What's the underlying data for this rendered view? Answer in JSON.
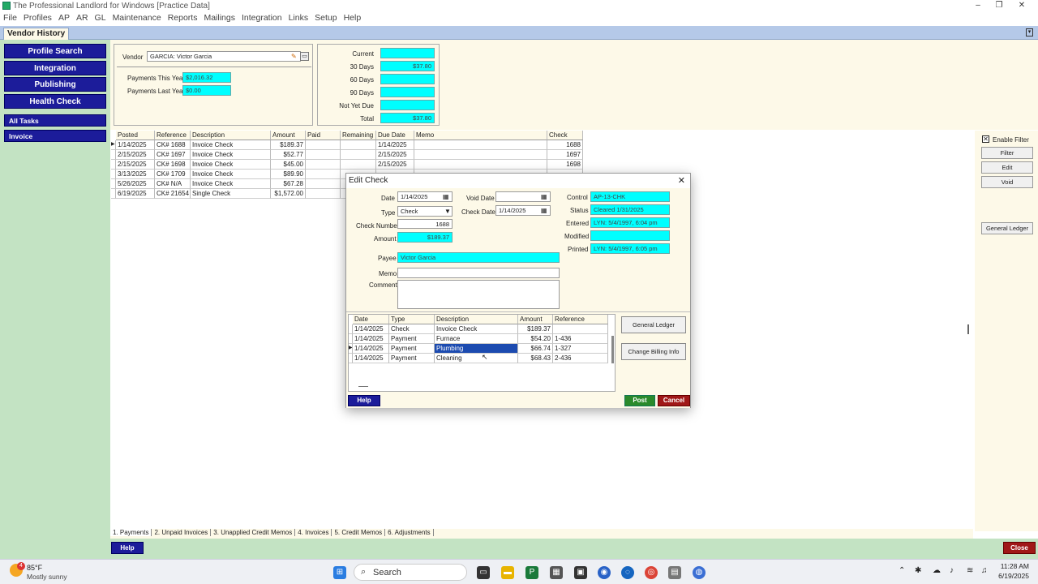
{
  "window": {
    "title": "The Professional Landlord for Windows [Practice Data]"
  },
  "menubar": [
    "File",
    "Profiles",
    "AP",
    "AR",
    "GL",
    "Maintenance",
    "Reports",
    "Mailings",
    "Integration",
    "Links",
    "Setup",
    "Help"
  ],
  "tab": {
    "label": "Vendor History"
  },
  "sidebar": {
    "buttons": [
      "Profile Search",
      "Integration",
      "Publishing",
      "Health Check"
    ],
    "sections": [
      "All Tasks",
      "Invoice"
    ]
  },
  "vendor": {
    "label": "Vendor",
    "value": "GARCIA: Victor Garcia",
    "payments_this_year_label": "Payments This Year",
    "payments_this_year": "$2,016.32",
    "payments_last_year_label": "Payments Last Year",
    "payments_last_year": "$0.00"
  },
  "aging": {
    "current_label": "Current",
    "current": "",
    "d30_label": "30 Days",
    "d30": "$37.80",
    "d60_label": "60 Days",
    "d60": "",
    "d90_label": "90 Days",
    "d90": "",
    "notdue_label": "Not Yet Due",
    "notdue": "",
    "total_label": "Total",
    "total": "$37.80"
  },
  "grid": {
    "headers": [
      "Posted",
      "Reference",
      "Description",
      "Amount",
      "Paid",
      "Remaining",
      "Due Date",
      "Memo",
      "Check"
    ],
    "rows": [
      [
        "1/14/2025",
        "CK# 1688",
        "Invoice Check",
        "$189.37",
        "",
        "",
        "1/14/2025",
        "",
        "1688"
      ],
      [
        "2/15/2025",
        "CK# 1697",
        "Invoice Check",
        "$52.77",
        "",
        "",
        "2/15/2025",
        "",
        "1697"
      ],
      [
        "2/15/2025",
        "CK# 1698",
        "Invoice Check",
        "$45.00",
        "",
        "",
        "2/15/2025",
        "",
        "1698"
      ],
      [
        "3/13/2025",
        "CK# 1709",
        "Invoice Check",
        "$89.90",
        "",
        "",
        "",
        "",
        ""
      ],
      [
        "5/26/2025",
        "CK# N/A",
        "Invoice Check",
        "$67.28",
        "",
        "",
        "",
        "",
        ""
      ],
      [
        "6/19/2025",
        "CK# 21654",
        "Single Check",
        "$1,572.00",
        "",
        "",
        "",
        "",
        ""
      ]
    ]
  },
  "right_panel": {
    "enable_filter": "Enable Filter",
    "buttons": [
      "Filter",
      "Edit",
      "Void",
      "General Ledger"
    ]
  },
  "bottom_tabs": [
    "1. Payments",
    "2. Unpaid Invoices",
    "3. Unapplied Credit Memos",
    "4. Invoices",
    "5. Credit Memos",
    "6. Adjustments"
  ],
  "bottom": {
    "help": "Help",
    "close": "Close"
  },
  "dialog": {
    "title": "Edit Check",
    "date_label": "Date",
    "date": "1/14/2025",
    "void_date_label": "Void Date",
    "void_date": "",
    "type_label": "Type",
    "type": "Check",
    "check_date_label": "Check Date",
    "check_date": "1/14/2025",
    "check_number_label": "Check Number",
    "check_number": "1688",
    "amount_label": "Amount",
    "amount": "$189.37",
    "payee_label": "Payee",
    "payee": "Victor Garcia",
    "memo_label": "Memo",
    "memo": "",
    "comment_label": "Comment",
    "comment": "",
    "control_label": "Control",
    "control": "AP-13-CHK",
    "status_label": "Status",
    "status": "Cleared 1/31/2025",
    "entered_label": "Entered",
    "entered": "LYN: 5/4/1997, 6:04 pm",
    "modified_label": "Modified",
    "modified": "",
    "printed_label": "Printed",
    "printed": "LYN: 5/4/1997, 6:05 pm",
    "grid_headers": [
      "Date",
      "Type",
      "Description",
      "Amount",
      "Reference"
    ],
    "grid_rows": [
      [
        "1/14/2025",
        "Check",
        "Invoice Check",
        "$189.37",
        ""
      ],
      [
        "1/14/2025",
        "Payment",
        "Furnace",
        "$54.20",
        "1-436"
      ],
      [
        "1/14/2025",
        "Payment",
        "Plumbing",
        "$66.74",
        "1-327"
      ],
      [
        "1/14/2025",
        "Payment",
        "Cleaning",
        "$68.43",
        "2-436"
      ]
    ],
    "general_ledger": "General Ledger",
    "change_billing": "Change Billing Info",
    "help": "Help",
    "post": "Post",
    "cancel": "Cancel"
  },
  "taskbar": {
    "weather_temp": "85°F",
    "weather_desc": "Mostly sunny",
    "weather_badge": "4",
    "search": "Search",
    "time": "11:28 AM",
    "date": "6/19/2025"
  }
}
